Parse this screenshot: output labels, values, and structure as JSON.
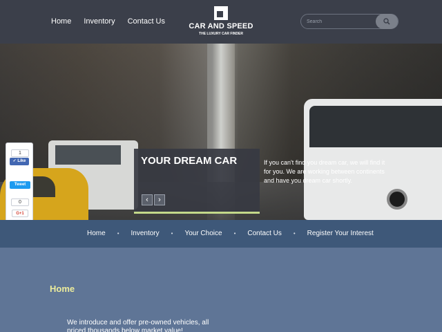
{
  "header": {
    "nav": [
      "Home",
      "Inventory",
      "Contact Us"
    ],
    "logo_title": "CAR AND SPEED",
    "logo_subtitle": "THE LUXURY CAR FINDER",
    "search_placeholder": "Search",
    "search_icon": "search-icon"
  },
  "hero": {
    "title": "YOUR DREAM CAR",
    "text": "If you can't find you dream car, we will find it for you. We are working between continents and have you dream car shortly.",
    "prev_arrow": "‹",
    "next_arrow": "›",
    "accent_color": "#c4d98a"
  },
  "social": {
    "like_count": "1",
    "like_label": "Like",
    "tweet_label": "Tweet",
    "gplus_count": "0",
    "gplus_label": "G+1"
  },
  "subnav": {
    "items": [
      "Home",
      "Inventory",
      "Your Choice",
      "Contact Us",
      "Register Your Interest"
    ],
    "separator": "•"
  },
  "content": {
    "heading": "Home",
    "intro": "We introduce and offer pre-owned vehicles, all priced thousands below market value!"
  },
  "colors": {
    "header_bg": "#3b3f4a",
    "subnav_bg": "#3e5879",
    "content_bg": "#5f7596",
    "heading_color": "#ecec9c"
  }
}
